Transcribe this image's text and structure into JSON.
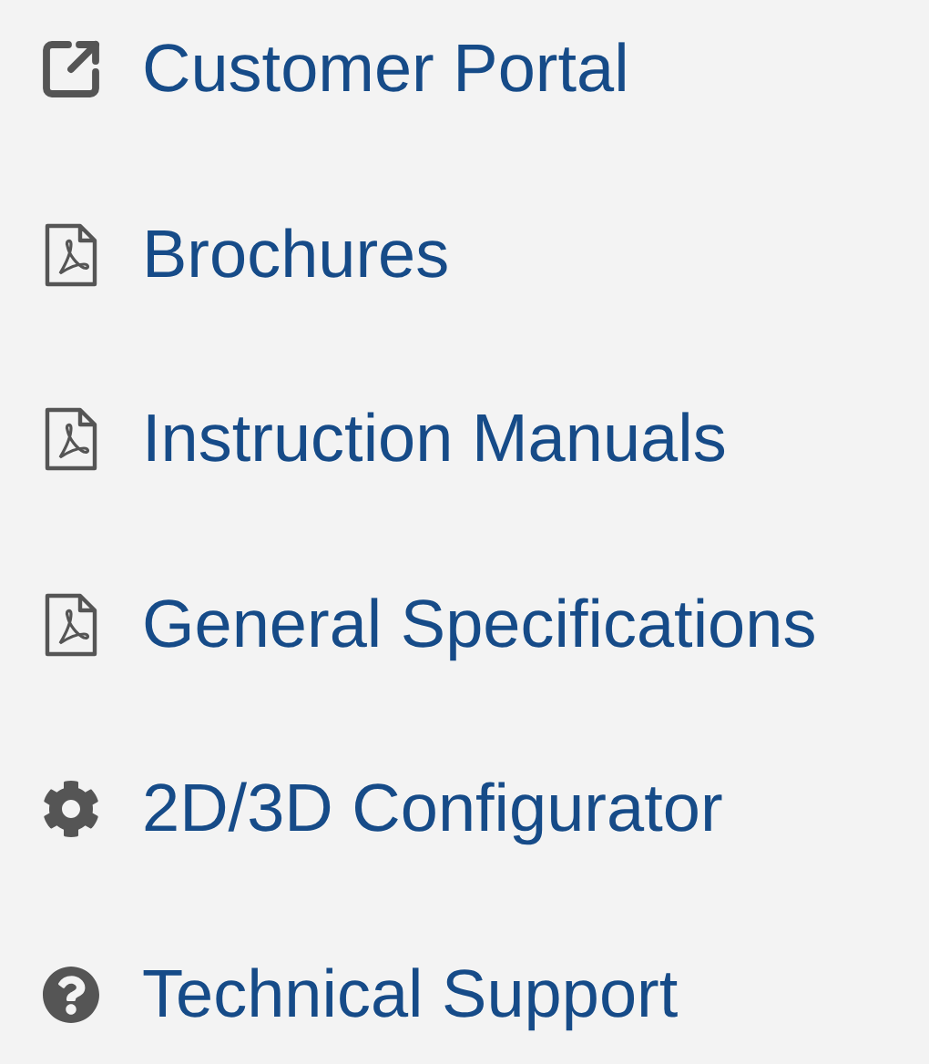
{
  "links": [
    {
      "kind": "external",
      "label": "Customer Portal"
    },
    {
      "kind": "pdf",
      "label": "Brochures"
    },
    {
      "kind": "pdf",
      "label": "Instruction Manuals"
    },
    {
      "kind": "pdf",
      "label": "General Specifications"
    },
    {
      "kind": "gear",
      "label": "2D/3D Configurator"
    },
    {
      "kind": "help",
      "label": "Technical Support"
    }
  ]
}
